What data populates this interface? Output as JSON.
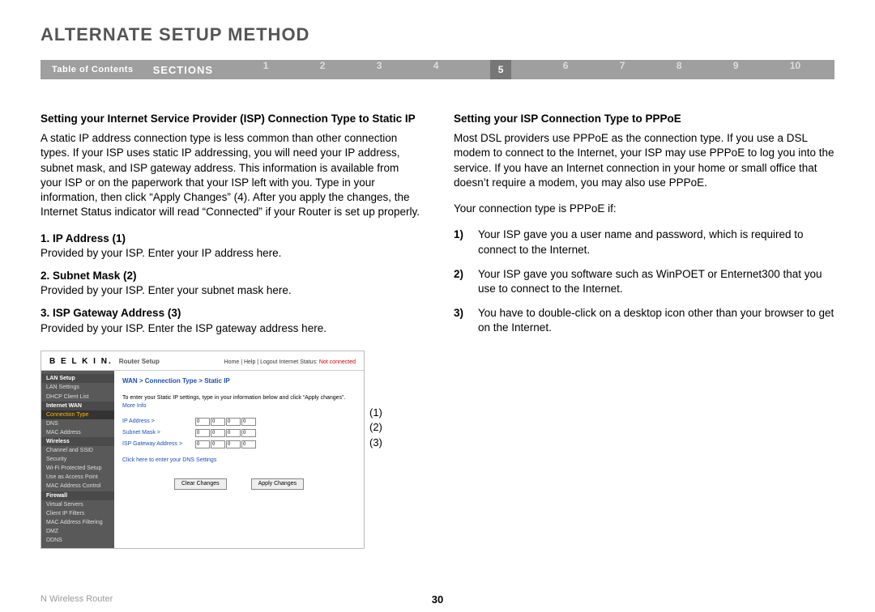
{
  "title": "ALTERNATE SETUP METHOD",
  "nav": {
    "toc": "Table of Contents",
    "sections": "SECTIONS",
    "nums": [
      "1",
      "2",
      "3",
      "4",
      "5",
      "6",
      "7",
      "8",
      "9",
      "10"
    ],
    "active": "5"
  },
  "left": {
    "heading": "Setting your Internet Service Provider (ISP) Connection Type to Static IP",
    "para": "A static IP address connection type is less common than other connection types. If your ISP uses static IP addressing, you will need your IP address, subnet mask, and ISP gateway address. This information is available from your ISP or on the paperwork that your ISP left with you. Type in your information, then click “Apply Changes” (4). After you apply the changes, the Internet Status indicator will read “Connected” if your Router is set up properly.",
    "fields": [
      {
        "head": "1.  IP Address (1)",
        "body": "Provided by your ISP. Enter your IP address here."
      },
      {
        "head": "2.  Subnet Mask (2)",
        "body": "Provided by your ISP. Enter your subnet mask here."
      },
      {
        "head": "3.  ISP Gateway Address (3)",
        "body": "Provided by your ISP. Enter the ISP gateway address here."
      }
    ]
  },
  "right": {
    "heading": "Setting your ISP Connection Type to PPPoE",
    "para": "Most DSL providers use PPPoE as the connection type. If you use a DSL modem to connect to the Internet, your ISP may use PPPoE to log you into the service. If you have an Internet connection in your home or small office that doesn’t require a modem, you may also use PPPoE.",
    "lead": "Your connection type is PPPoE if:",
    "list": [
      {
        "n": "1)",
        "t": "Your ISP gave you a user name and password, which is required to connect to the Internet."
      },
      {
        "n": "2)",
        "t": "Your ISP gave you software such as WinPOET or Enternet300 that you use to connect to the Internet."
      },
      {
        "n": "3)",
        "t": "You have to double-click on a desktop icon other than your browser to get on the Internet."
      }
    ]
  },
  "router": {
    "brand": "B E L K I N.",
    "sub": "Router Setup",
    "links_plain": "Home | Help | Logout   Internet Status:",
    "links_status": "Not connected",
    "side": {
      "items": [
        {
          "t": "LAN Setup",
          "cls": "hdr"
        },
        {
          "t": "LAN Settings",
          "cls": ""
        },
        {
          "t": "DHCP Client List",
          "cls": ""
        },
        {
          "t": "Internet WAN",
          "cls": "hdr"
        },
        {
          "t": "Connection Type",
          "cls": "sel"
        },
        {
          "t": "DNS",
          "cls": ""
        },
        {
          "t": "MAC Address",
          "cls": ""
        },
        {
          "t": "Wireless",
          "cls": "hdr"
        },
        {
          "t": "Channel and SSID",
          "cls": ""
        },
        {
          "t": "Security",
          "cls": ""
        },
        {
          "t": "Wi-Fi Protected Setup",
          "cls": ""
        },
        {
          "t": "Use as Access Point",
          "cls": ""
        },
        {
          "t": "MAC Address Control",
          "cls": ""
        },
        {
          "t": "Firewall",
          "cls": "hdr"
        },
        {
          "t": "Virtual Servers",
          "cls": ""
        },
        {
          "t": "Client IP Filters",
          "cls": ""
        },
        {
          "t": "MAC Address Filtering",
          "cls": ""
        },
        {
          "t": "DMZ",
          "cls": ""
        },
        {
          "t": "DDNS",
          "cls": ""
        }
      ]
    },
    "crumb": "WAN > Connection Type > Static IP",
    "instr_a": "To enter your Static IP settings, type in your information below and click “Apply changes”. ",
    "instr_b": "More Info",
    "rows": [
      {
        "lbl": "IP Address >",
        "v": [
          "0",
          "0",
          "0",
          "0"
        ]
      },
      {
        "lbl": "Subnet Mask >",
        "v": [
          "0",
          "0",
          "0",
          "0"
        ]
      },
      {
        "lbl": "ISP Gateway Address >",
        "v": [
          "0",
          "0",
          "0",
          "0"
        ]
      }
    ],
    "dns": "Click here to enter your DNS Settings",
    "btn_clear": "Clear Changes",
    "btn_apply": "Apply Changes"
  },
  "callouts": [
    "(1)",
    "(2)",
    "(3)"
  ],
  "footer": {
    "product": "N Wireless Router",
    "page": "30"
  }
}
